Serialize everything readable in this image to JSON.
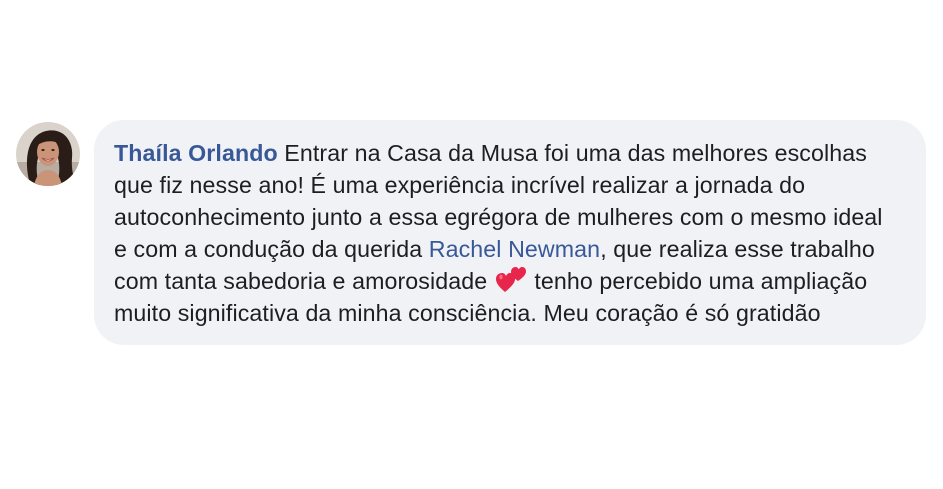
{
  "comment": {
    "author_name": "Thaíla Orlando",
    "text_part1": " Entrar na Casa da Musa foi uma das melhores escolhas que fiz nesse ano! É uma experiência incrível realizar a jornada do autoconhecimento junto a essa egrégora de mulheres com o mesmo ideal e com a condução da querida ",
    "mention_name": "Rachel Newman",
    "text_part2": ", que realiza esse trabalho com tanta sabedoria e amorosidade ",
    "emoji": "two-hearts-icon",
    "text_part3": " tenho percebido uma ampliação muito significativa da minha consciência. Meu coração é só gratidão"
  },
  "colors": {
    "bubble_background": "#f0f2f5",
    "link": "#385898",
    "text": "#1c1e21",
    "heart": "#e8254a"
  }
}
